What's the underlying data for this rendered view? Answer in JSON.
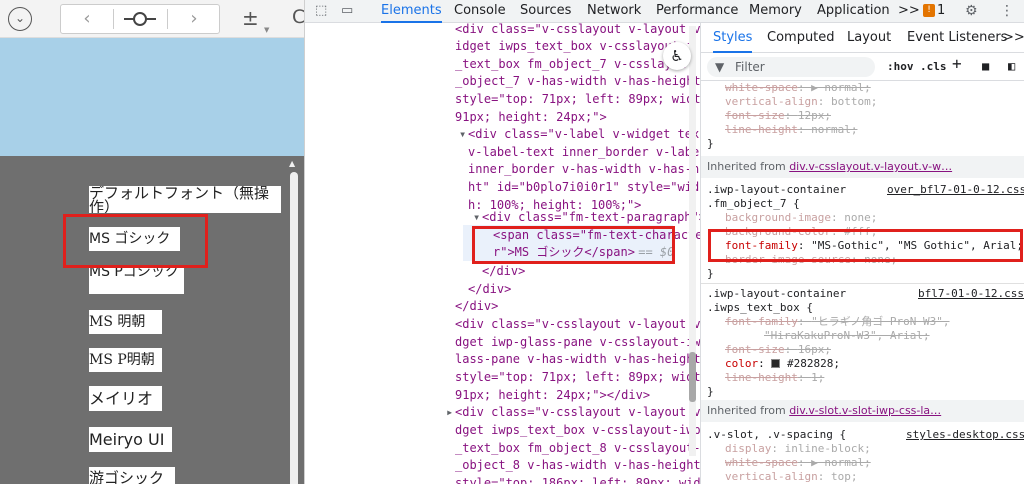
{
  "left_toolbar": {
    "nav_back_icon": "chevron-left",
    "nav_forward_icon": "chevron-right",
    "plus_minus": "±",
    "cut_char": "C"
  },
  "font_list": [
    {
      "label": "デフォルトフォント（無操作）"
    },
    {
      "label": "MS ゴシック"
    },
    {
      "label": "MS Pゴシック"
    },
    {
      "label": "MS 明朝"
    },
    {
      "label": "MS P明朝"
    },
    {
      "label": "メイリオ"
    },
    {
      "label": "Meiryo UI"
    },
    {
      "label": "游ゴシック"
    }
  ],
  "devtools": {
    "tabs": [
      "Elements",
      "Console",
      "Sources",
      "Network",
      "Performance",
      "Memory",
      "Application"
    ],
    "active_tab": "Elements",
    "more": ">>",
    "issue_count": "1"
  },
  "elements": {
    "l1a": "<div class=\"v-csslayout v-layout v-w",
    "l1b": "idget iwps_text_box v-csslayout-i",
    "l1c": "_text_box fm_object_7 v-csslayou",
    "l1d": "_object_7 v-has-width v-has-height\"",
    "l1e": "style=\"top: 71px; left: 89px; width:",
    "l1f": "91px; height: 24px;\">",
    "l2a": "<div class=\"v-label v-widget text",
    "l2b": "v-label-text inner_border v-label-",
    "l2c": "inner_border v-has-width v-has-heig",
    "l2d": "ht\" id=\"b0plo7i0i0r1\" style=\"widt",
    "l2e": "h: 100%; height: 100%;\">",
    "l3": "<div class=\"fm-text-paragraph\">",
    "l4a": "<span class=\"fm-text-characte",
    "l4b": "r\">MS ゴシック</span>",
    "l4c": " == $0",
    "l5": "</div>",
    "l6": "</div>",
    "l7": "</div>",
    "l8a": "<div class=\"v-csslayout v-layout v-wi",
    "l8b": "dget iwp-glass-pane v-csslayout-iwp-g",
    "l8c": "lass-pane v-has-width v-has-height\"",
    "l8d": "style=\"top: 71px; left: 89px; width:",
    "l8e": "91px; height: 24px;\"></div>",
    "l9a": "<div class=\"v-csslayout v-layout v-wi",
    "l9b": "dget iwps_text_box v-csslayout-iwps",
    "l9c": "_text_box fm_object_8 v-csslayout-fm",
    "l9d": "_object_8 v-has-width v-has-height\"",
    "l9e": "style=\"top: 186px; left: 89px; widt"
  },
  "styles": {
    "tabs": [
      "Styles",
      "Computed",
      "Layout",
      "Event Listeners",
      ">>"
    ],
    "active_tab": "Styles",
    "filter_placeholder": "Filter",
    "hov": ":hov",
    "cls": ".cls",
    "top_rules": [
      {
        "name": "white-space",
        "value": "▶ normal;"
      },
      {
        "name": "vertical-align",
        "value": "bottom;"
      },
      {
        "name": "font-size",
        "value": "12px;"
      },
      {
        "name": "line-height",
        "value": "normal;"
      }
    ],
    "inherited1": {
      "label": "Inherited from",
      "selector": "div.v-csslayout.v-layout.v-w…"
    },
    "rule1": {
      "sel1": ".iwp-layout-container",
      "sel2": ".fm_object_7 {",
      "source": "over_bfl7-01-0-12.css:",
      "bg_name": "background-image",
      "bg_value": "none;",
      "bgc_name": "background-color",
      "bgc_value": "#fff;",
      "ff_name": "font-family",
      "ff_value": "\"MS-Gothic\", \"MS Gothic\", Arial;",
      "bis_name": "border-image-source",
      "bis_value": "none;"
    },
    "rule2": {
      "sel1": ".iwp-layout-container",
      "sel2": ".iwps_text_box {",
      "source": "bfl7-01-0-12.css:",
      "ff_name": "font-family",
      "ff_value": "\"ヒラギノ角ゴ ProN W3\",",
      "ff_value2": "\"HiraKakuProN-W3\", Arial;",
      "fs_name": "font-size",
      "fs_value": "16px;",
      "color_name": "color",
      "color_value": "#282828;",
      "lh_name": "line-height",
      "lh_value": "1;"
    },
    "inherited2": {
      "label": "Inherited from",
      "selector": "div.v-slot.v-slot-iwp-css-la…"
    },
    "rule3": {
      "sel": ".v-slot, .v-spacing {",
      "source": "styles-desktop.css:",
      "display_name": "display",
      "display_value": "inline-block;",
      "ws_name": "white-space",
      "ws_value": "▶ normal;",
      "va_name": "vertical-align",
      "va_value": "top;"
    },
    "close_brace": "}"
  }
}
